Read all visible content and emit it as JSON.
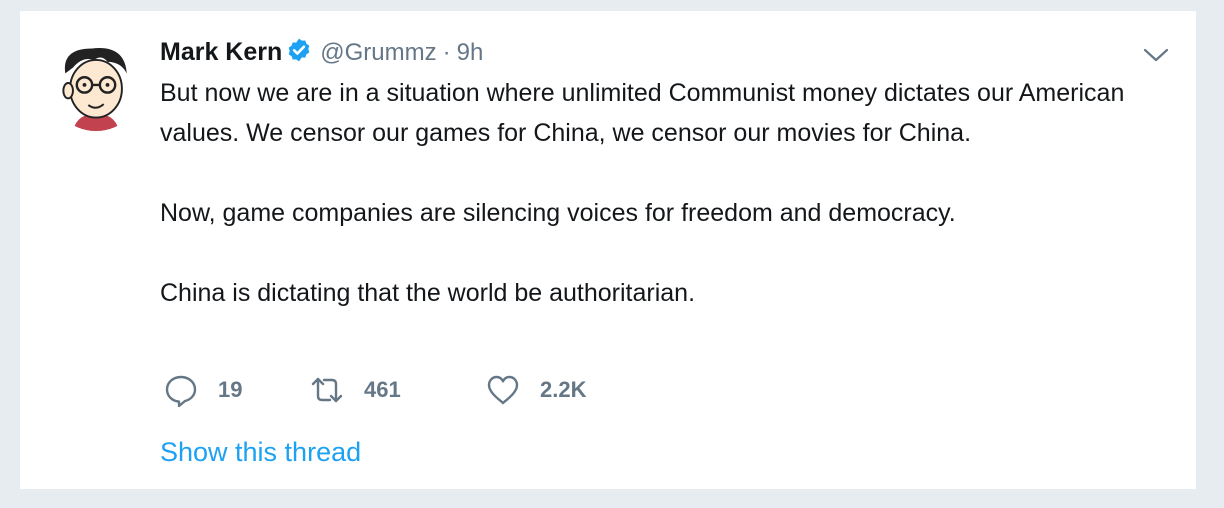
{
  "tweet": {
    "author_name": "Mark Kern",
    "handle": "@Grummz",
    "separator": "·",
    "time": "9h",
    "paragraphs": [
      "But now we are in a situation where unlimited Communist money dictates our American values. We censor our games for China, we censor our movies for China.",
      "Now, game companies are silencing voices for freedom and democracy.",
      "China is dictating that the world be authoritarian."
    ],
    "reply_count": "19",
    "retweet_count": "461",
    "like_count": "2.2K",
    "show_thread_label": "Show this thread"
  },
  "icons": {
    "verified": "verified-badge-icon",
    "menu": "chevron-down-icon",
    "reply": "reply-icon",
    "retweet": "retweet-icon",
    "like": "heart-icon"
  },
  "colors": {
    "verified": "#1da1f2",
    "link": "#1da1f2",
    "muted": "#657786",
    "text": "#14171a",
    "background": "#e6ecf0"
  }
}
